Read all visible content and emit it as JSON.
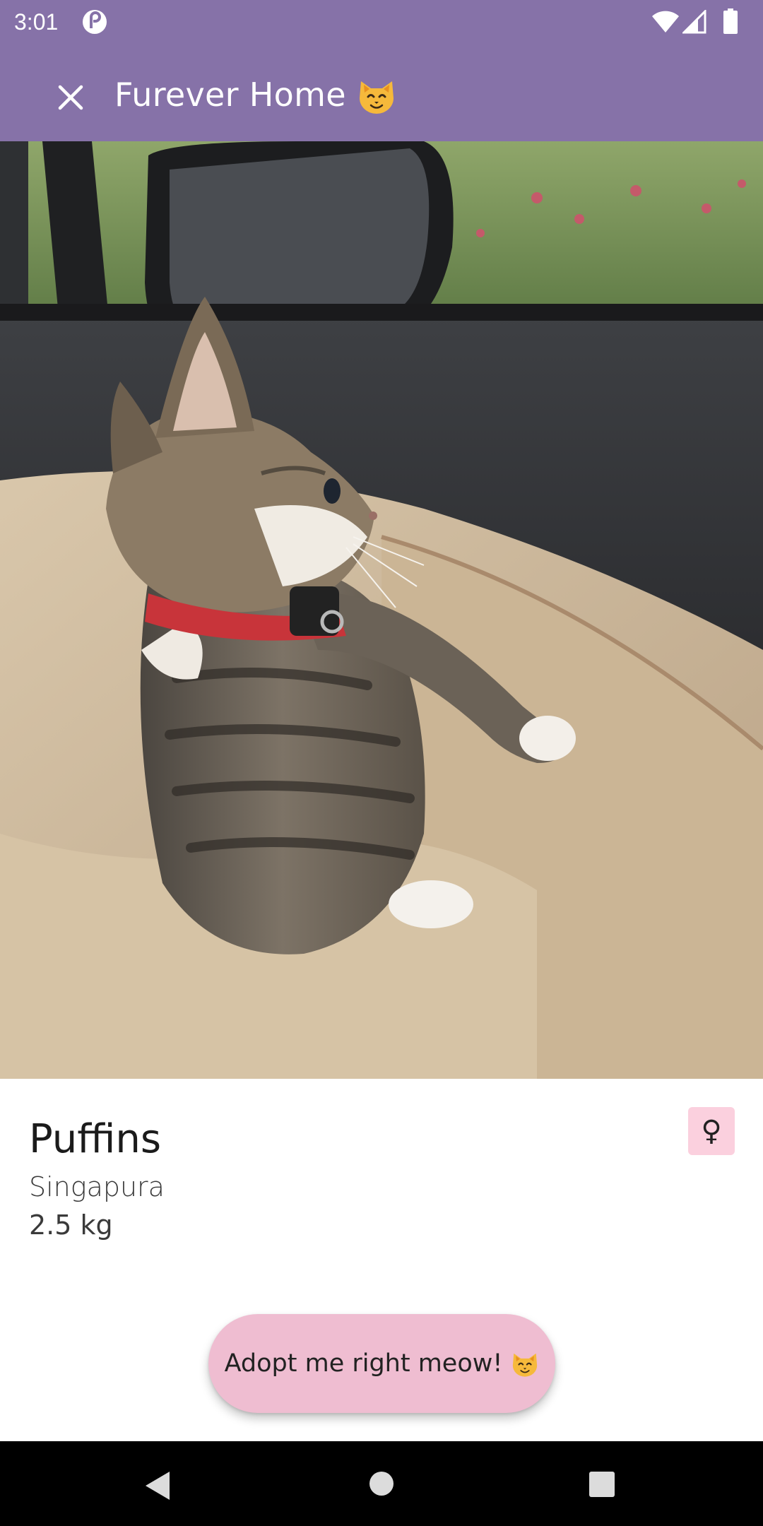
{
  "status_bar": {
    "time": "3:01",
    "app_icon": "pocket-casts-icon",
    "wifi_icon": "wifi-icon",
    "signal_icon": "cell-signal-icon",
    "battery_icon": "battery-icon"
  },
  "app_bar": {
    "close_icon": "close-icon",
    "title": "Furever Home",
    "title_emoji": "cat-face-emoji",
    "background_color": "#8672a8"
  },
  "hero_image": {
    "subject": "kitten-photo"
  },
  "pet": {
    "name": "Puffins",
    "breed": "Singapura",
    "weight": "2.5 kg",
    "gender_symbol": "♀",
    "gender_badge_color": "#fbd0de"
  },
  "adopt_button": {
    "label": "Adopt me right meow!",
    "emoji": "cat-face-emoji",
    "color": "#efbdd1"
  },
  "nav_bar": {
    "back_icon": "back-triangle-icon",
    "home_icon": "home-circle-icon",
    "recents_icon": "recents-square-icon"
  }
}
